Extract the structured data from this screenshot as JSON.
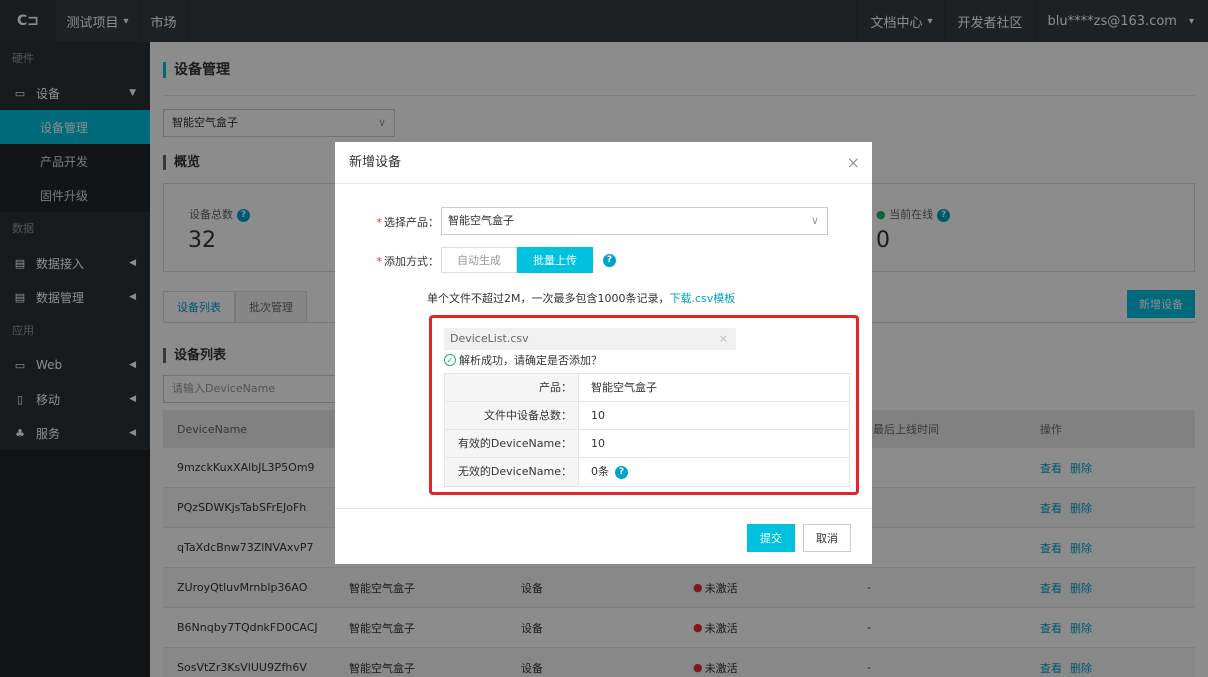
{
  "topbar": {
    "logo": "C⊐",
    "project": "测试项目",
    "market": "市场",
    "docs": "文档中心",
    "community": "开发者社区",
    "user": "blu****zs@163.com"
  },
  "sidebar": {
    "sec_hardware": "硬件",
    "device": "设备",
    "device_manage": "设备管理",
    "product_dev": "产品开发",
    "firmware": "固件升级",
    "sec_data": "数据",
    "data_access": "数据接入",
    "data_manage": "数据管理",
    "sec_app": "应用",
    "web": "Web",
    "mobile": "移动",
    "service": "服务"
  },
  "main": {
    "page_title": "设备管理",
    "product_select": "智能空气盒子",
    "overview_title": "概览",
    "total_label": "设备总数",
    "total_value": "32",
    "online_label": "当前在线",
    "online_value": "0",
    "tab_list": "设备列表",
    "tab_batch": "批次管理",
    "add_device_btn": "新增设备",
    "list_title": "设备列表",
    "search_placeholder": "请输入DeviceName",
    "col_devicename": "DeviceName",
    "col_last_online": "最后上线时间",
    "col_ops": "操作",
    "view": "查看",
    "delete": "删除",
    "rows": [
      {
        "name": "9mzckKuxXAlbJL3P5Om9",
        "product": "",
        "type": "",
        "status": "",
        "last": ""
      },
      {
        "name": "PQzSDWKjsTabSFrEJoFh",
        "product": "",
        "type": "",
        "status": "",
        "last": ""
      },
      {
        "name": "qTaXdcBnw73ZlNVAxvP7",
        "product": "",
        "type": "",
        "status": "",
        "last": ""
      },
      {
        "name": "ZUroyQtluvMrnblp36AO",
        "product": "智能空气盒子",
        "type": "设备",
        "status": "未激活",
        "last": "-"
      },
      {
        "name": "B6Nnqby7TQdnkFD0CACJ",
        "product": "智能空气盒子",
        "type": "设备",
        "status": "未激活",
        "last": "-"
      },
      {
        "name": "SosVtZr3KsVlUU9Zfh6V",
        "product": "智能空气盒子",
        "type": "设备",
        "status": "未激活",
        "last": "-"
      }
    ]
  },
  "modal": {
    "title": "新增设备",
    "label_product": "选择产品：",
    "product_value": "智能空气盒子",
    "label_method": "添加方式：",
    "method_auto": "自动生成",
    "method_batch": "批量上传",
    "hint": "单个文件不超过2M，一次最多包含1000条记录，",
    "hint_link": "下载.csv模板",
    "file_name": "DeviceList.csv",
    "parse_ok": "解析成功，请确定是否添加？",
    "info": [
      {
        "k": "产品：",
        "v": "智能空气盒子"
      },
      {
        "k": "文件中设备总数：",
        "v": "10"
      },
      {
        "k": "有效的DeviceName：",
        "v": "10"
      },
      {
        "k": "无效的DeviceName：",
        "v": "0条"
      }
    ],
    "submit": "提交",
    "cancel": "取消"
  },
  "colors": {
    "accent": "#00c1de",
    "topbar": "#373d41",
    "sidebar": "#1e2226",
    "highlight": "#e0252b"
  }
}
